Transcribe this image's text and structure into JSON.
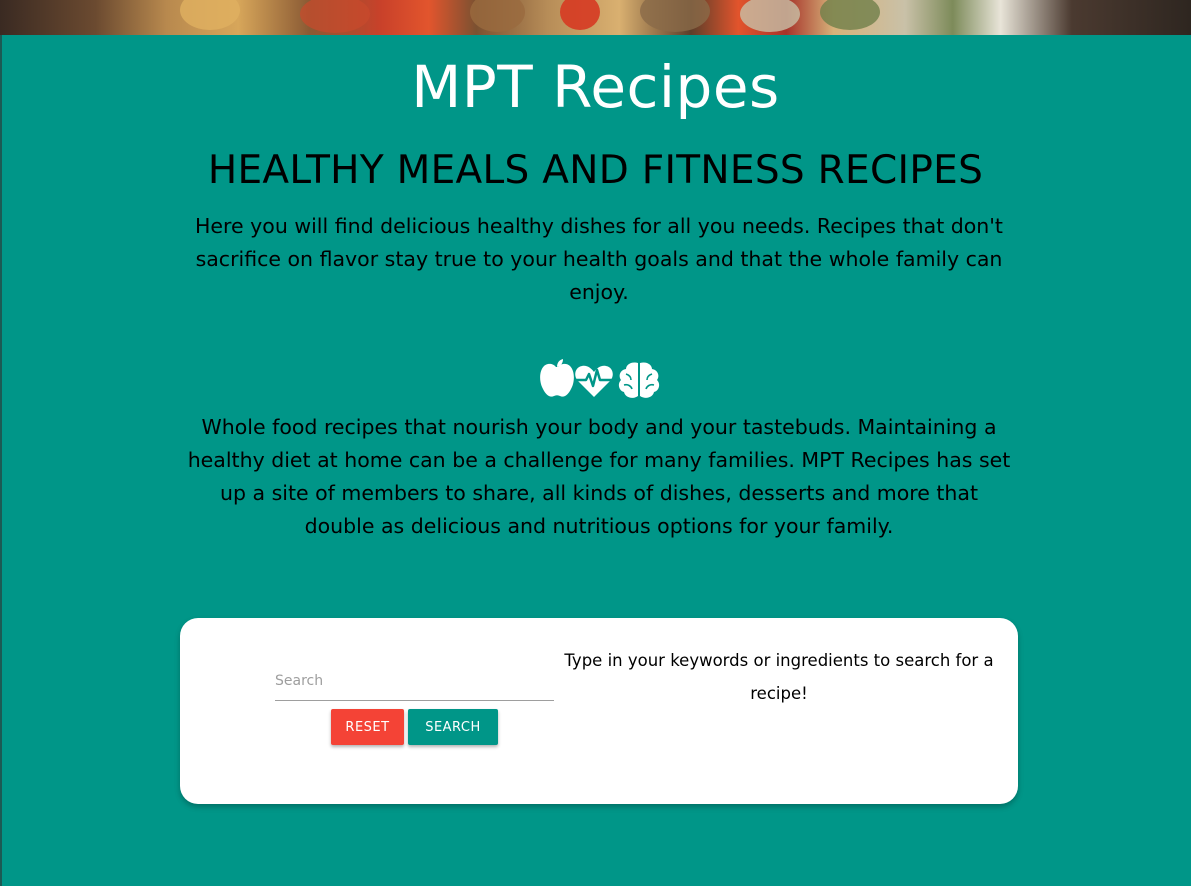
{
  "header": {
    "title": "MPT Recipes",
    "subtitle": "HEALTHY MEALS AND FITNESS RECIPES"
  },
  "intro": "Here you will find delicious healthy dishes for all you needs. Recipes that don't sacrifice on flavor stay true to your health goals and that the whole family can enjoy.",
  "icons": [
    "apple-icon",
    "heartbeat-icon",
    "brain-icon"
  ],
  "description": "Whole food recipes that nourish your body and your tastebuds. Maintaining a healthy diet at home can be a challenge for many families. MPT Recipes has set up a site of members to share, all kinds of dishes, desserts and more that double as delicious and nutritious options for your family.",
  "search": {
    "placeholder": "Search",
    "value": "",
    "reset_label": "RESET",
    "search_label": "SEARCH",
    "hint": "Type in your keywords or ingredients to search for a recipe!"
  },
  "colors": {
    "background": "#009688",
    "reset_button": "#f44336",
    "search_button": "#009688"
  }
}
